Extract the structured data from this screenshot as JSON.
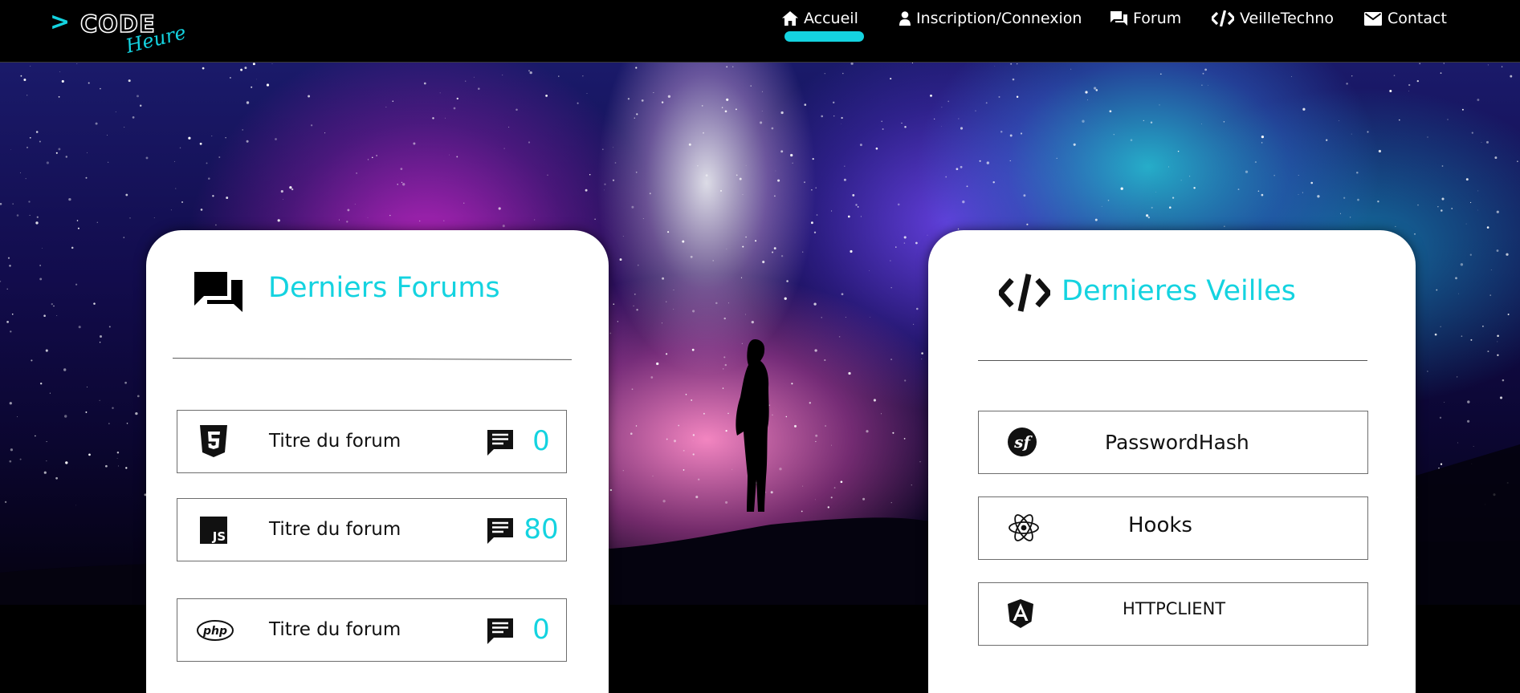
{
  "logo": {
    "prefix": ">",
    "word": "CODE",
    "script": "Heure",
    "accent_color": "#14d3e0"
  },
  "nav": {
    "items": [
      {
        "label": "Accueil",
        "icon": "home-icon",
        "active": true
      },
      {
        "label": "Inscription/Connexion",
        "icon": "user-icon"
      },
      {
        "label": "Forum",
        "icon": "forum-icon"
      },
      {
        "label": "VeilleTechno",
        "icon": "code-icon"
      },
      {
        "label": "Contact",
        "icon": "mail-icon"
      }
    ]
  },
  "forums": {
    "title": "Derniers Forums",
    "icon": "forum-icon",
    "rows": [
      {
        "icon": "html5-icon",
        "title": "Titre du forum",
        "count": "0"
      },
      {
        "icon": "javascript-icon",
        "title": "Titre du forum",
        "count": "80"
      },
      {
        "icon": "php-icon",
        "title": "Titre du forum",
        "count": "0"
      }
    ]
  },
  "veilles": {
    "title": "Dernieres Veilles",
    "icon": "code-icon",
    "rows": [
      {
        "icon": "symfony-icon",
        "title": "PasswordHash"
      },
      {
        "icon": "react-icon",
        "title": "Hooks"
      },
      {
        "icon": "angular-icon",
        "title": "HTTPCLIENT"
      }
    ]
  },
  "colors": {
    "accent": "#14d3e0",
    "nav_bg": "#000000",
    "card_bg": "#ffffff"
  }
}
